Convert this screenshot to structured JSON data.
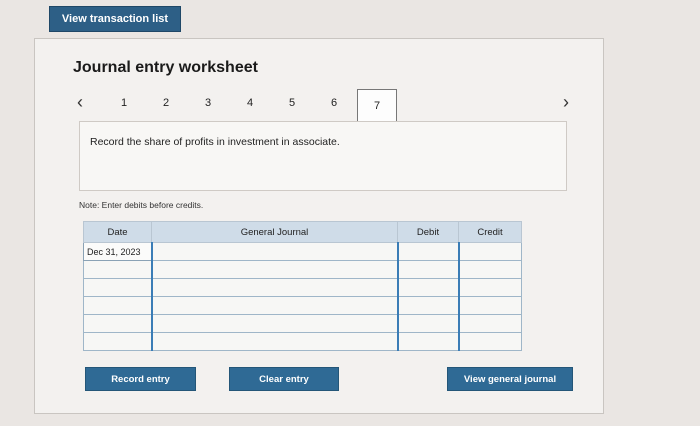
{
  "top": {
    "view_transactions_label": "View transaction list"
  },
  "worksheet": {
    "title": "Journal entry worksheet",
    "steps": [
      "1",
      "2",
      "3",
      "4",
      "5",
      "6",
      "7"
    ],
    "active_step": "7",
    "instruction": "Record the share of profits in investment in associate.",
    "note": "Note: Enter debits before credits."
  },
  "table": {
    "headers": {
      "date": "Date",
      "journal": "General Journal",
      "debit": "Debit",
      "credit": "Credit"
    },
    "rows": [
      {
        "date": "Dec 31, 2023",
        "account": "",
        "debit": "",
        "credit": ""
      },
      {
        "date": "",
        "account": "",
        "debit": "",
        "credit": ""
      },
      {
        "date": "",
        "account": "",
        "debit": "",
        "credit": ""
      },
      {
        "date": "",
        "account": "",
        "debit": "",
        "credit": ""
      },
      {
        "date": "",
        "account": "",
        "debit": "",
        "credit": ""
      },
      {
        "date": "",
        "account": "",
        "debit": "",
        "credit": ""
      }
    ]
  },
  "buttons": {
    "record": "Record entry",
    "clear": "Clear entry",
    "view_journal": "View general journal"
  },
  "icons": {
    "prev": "chevron-left-icon",
    "next": "chevron-right-icon"
  }
}
